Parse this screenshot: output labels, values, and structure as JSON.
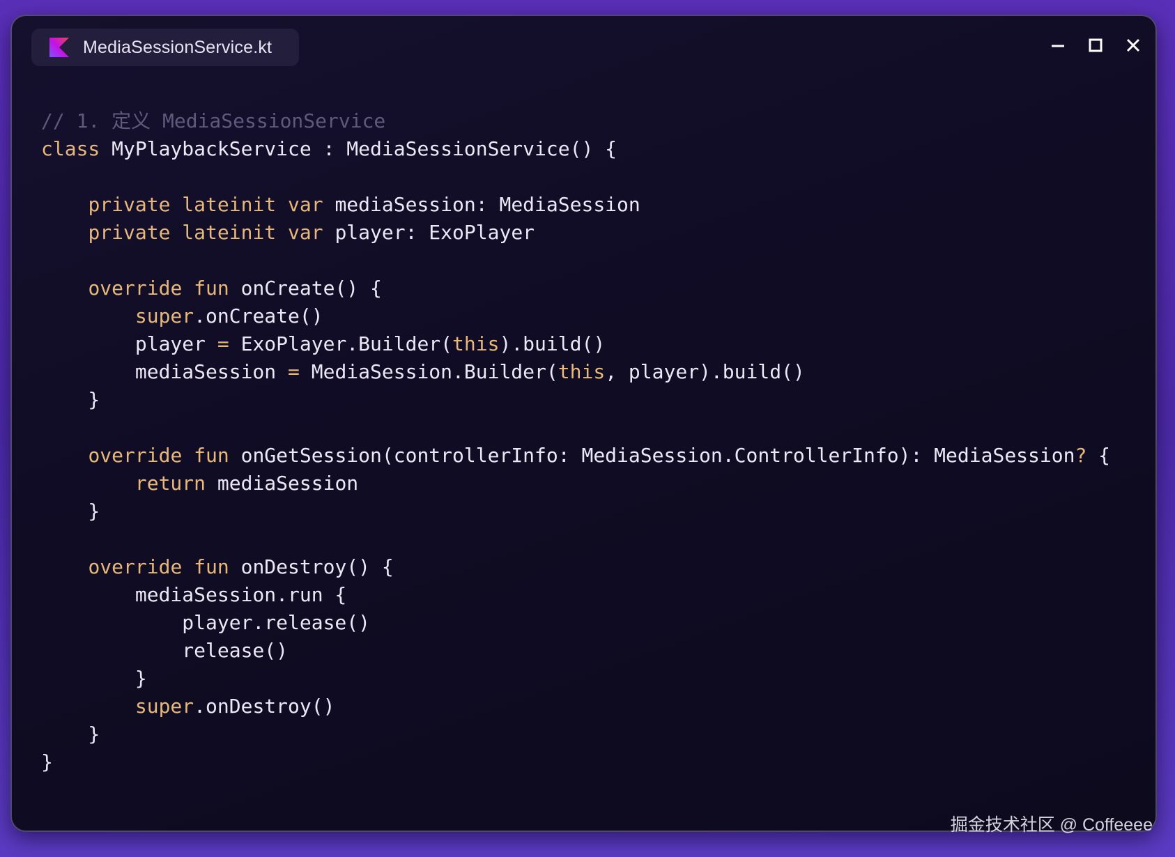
{
  "window": {
    "tab_title": "MediaSessionService.kt",
    "file_icon": "kotlin-icon",
    "controls": [
      {
        "name": "minimize-icon",
        "label": "minimize"
      },
      {
        "name": "maximize-icon",
        "label": "maximize"
      },
      {
        "name": "close-icon",
        "label": "close"
      }
    ]
  },
  "colors": {
    "keyword": "#e7b87a",
    "comment": "#5f5a7a",
    "text": "#ece8f6",
    "window_bg": "#100c24",
    "page_bg": "#5a2fb8"
  },
  "code": {
    "language": "kotlin",
    "lines": [
      [
        [
          "cmt",
          "// 1. 定义 MediaSessionService"
        ]
      ],
      [
        [
          "kw",
          "class"
        ],
        [
          "txt",
          " MyPlaybackService : MediaSessionService() {"
        ]
      ],
      [],
      [
        [
          "txt",
          "    "
        ],
        [
          "kw",
          "private lateinit var"
        ],
        [
          "txt",
          " mediaSession: MediaSession"
        ]
      ],
      [
        [
          "txt",
          "    "
        ],
        [
          "kw",
          "private lateinit var"
        ],
        [
          "txt",
          " player: ExoPlayer"
        ]
      ],
      [],
      [
        [
          "txt",
          "    "
        ],
        [
          "kw",
          "override fun"
        ],
        [
          "txt",
          " onCreate() {"
        ]
      ],
      [
        [
          "txt",
          "        "
        ],
        [
          "kw",
          "super"
        ],
        [
          "txt",
          ".onCreate()"
        ]
      ],
      [
        [
          "txt",
          "        player "
        ],
        [
          "kw",
          "="
        ],
        [
          "txt",
          " ExoPlayer.Builder("
        ],
        [
          "kw",
          "this"
        ],
        [
          "txt",
          ").build()"
        ]
      ],
      [
        [
          "txt",
          "        mediaSession "
        ],
        [
          "kw",
          "="
        ],
        [
          "txt",
          " MediaSession.Builder("
        ],
        [
          "kw",
          "this"
        ],
        [
          "txt",
          ", player).build()"
        ]
      ],
      [
        [
          "txt",
          "    }"
        ]
      ],
      [],
      [
        [
          "txt",
          "    "
        ],
        [
          "kw",
          "override fun"
        ],
        [
          "txt",
          " onGetSession(controllerInfo: MediaSession.ControllerInfo): MediaSession"
        ],
        [
          "kw",
          "?"
        ],
        [
          "txt",
          " {"
        ]
      ],
      [
        [
          "txt",
          "        "
        ],
        [
          "kw",
          "return"
        ],
        [
          "txt",
          " mediaSession"
        ]
      ],
      [
        [
          "txt",
          "    }"
        ]
      ],
      [],
      [
        [
          "txt",
          "    "
        ],
        [
          "kw",
          "override fun"
        ],
        [
          "txt",
          " onDestroy() {"
        ]
      ],
      [
        [
          "txt",
          "        mediaSession.run {"
        ]
      ],
      [
        [
          "txt",
          "            player.release()"
        ]
      ],
      [
        [
          "txt",
          "            release()"
        ]
      ],
      [
        [
          "txt",
          "        }"
        ]
      ],
      [
        [
          "txt",
          "        "
        ],
        [
          "kw",
          "super"
        ],
        [
          "txt",
          ".onDestroy()"
        ]
      ],
      [
        [
          "txt",
          "    }"
        ]
      ],
      [
        [
          "txt",
          "}"
        ]
      ]
    ]
  },
  "watermark": "掘金技术社区 @ Coffeeee"
}
